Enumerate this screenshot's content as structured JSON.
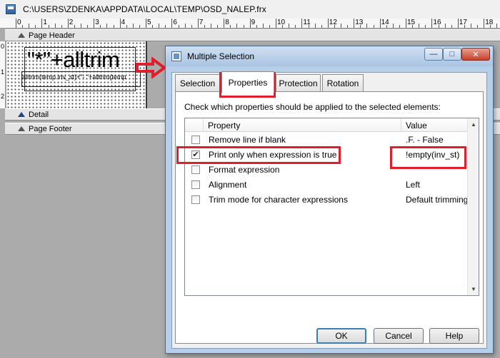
{
  "designer": {
    "file_path": "C:\\USERS\\ZDENKA\\APPDATA\\LOCAL\\TEMP\\OSD_NALEP.frx",
    "ruler_numbers": [
      "0",
      "1",
      "2",
      "3",
      "4",
      "5",
      "6",
      "7",
      "8",
      "9",
      "10",
      "11",
      "12",
      "13",
      "14",
      "15",
      "16",
      "17",
      "18"
    ],
    "vertical_ruler_numbers": [
      "0",
      "1",
      "2"
    ],
    "bands": {
      "page_header": "Page Header",
      "detail": "Detail",
      "page_footer": "Page Footer"
    },
    "field_large_text": "\"*\"+alltrim",
    "field_small_text": "alltrim(temp.inv_st)+\"- \"+alltrim(temp"
  },
  "dialog": {
    "title": "Multiple Selection",
    "tabs": [
      "Selection",
      "Properties",
      "Protection",
      "Rotation"
    ],
    "active_tab": "Properties",
    "instructions": "Check which properties should be applied to the selected elements:",
    "columns": {
      "property": "Property",
      "value": "Value"
    },
    "rows": [
      {
        "checked": false,
        "property": "Remove line if blank",
        "value": ".F. - False"
      },
      {
        "checked": true,
        "property": "Print only when expression is true",
        "value": "!empty(inv_st)"
      },
      {
        "checked": false,
        "property": "Format expression",
        "value": ""
      },
      {
        "checked": false,
        "property": "Alignment",
        "value": "Left"
      },
      {
        "checked": false,
        "property": "Trim mode for character expressions",
        "value": "Default trimming"
      }
    ],
    "buttons": {
      "ok": "OK",
      "cancel": "Cancel",
      "help": "Help"
    }
  },
  "colors": {
    "highlight_red": "#e11e2b",
    "dialog_frame": "#b7cfe8"
  }
}
